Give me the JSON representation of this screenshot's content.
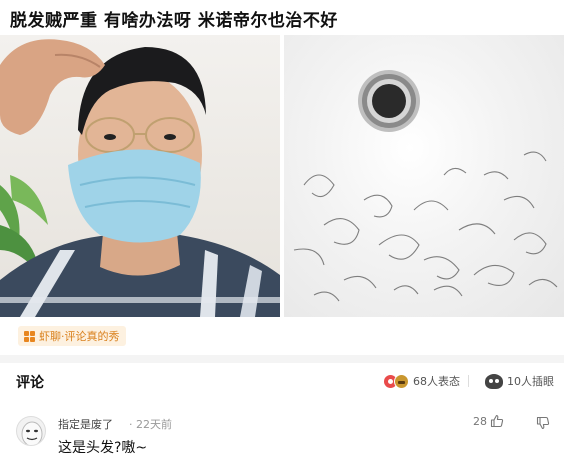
{
  "post": {
    "title": "脱发贼严重 有啥办法呀 米诺帝尔也治不好"
  },
  "tag": {
    "icon": "grid-icon",
    "label": "虾聊·评论真的秀"
  },
  "comments_section": {
    "title": "评论",
    "reactions_label": "68人表态",
    "eye_label": "10人插眼"
  },
  "comment": {
    "username": "指定是废了",
    "time": "· 22天前",
    "text": "这是头发?嗷~",
    "likes": "28"
  },
  "colors": {
    "tag_accent": "#e8861f",
    "tag_background": "#fdf1e0"
  }
}
